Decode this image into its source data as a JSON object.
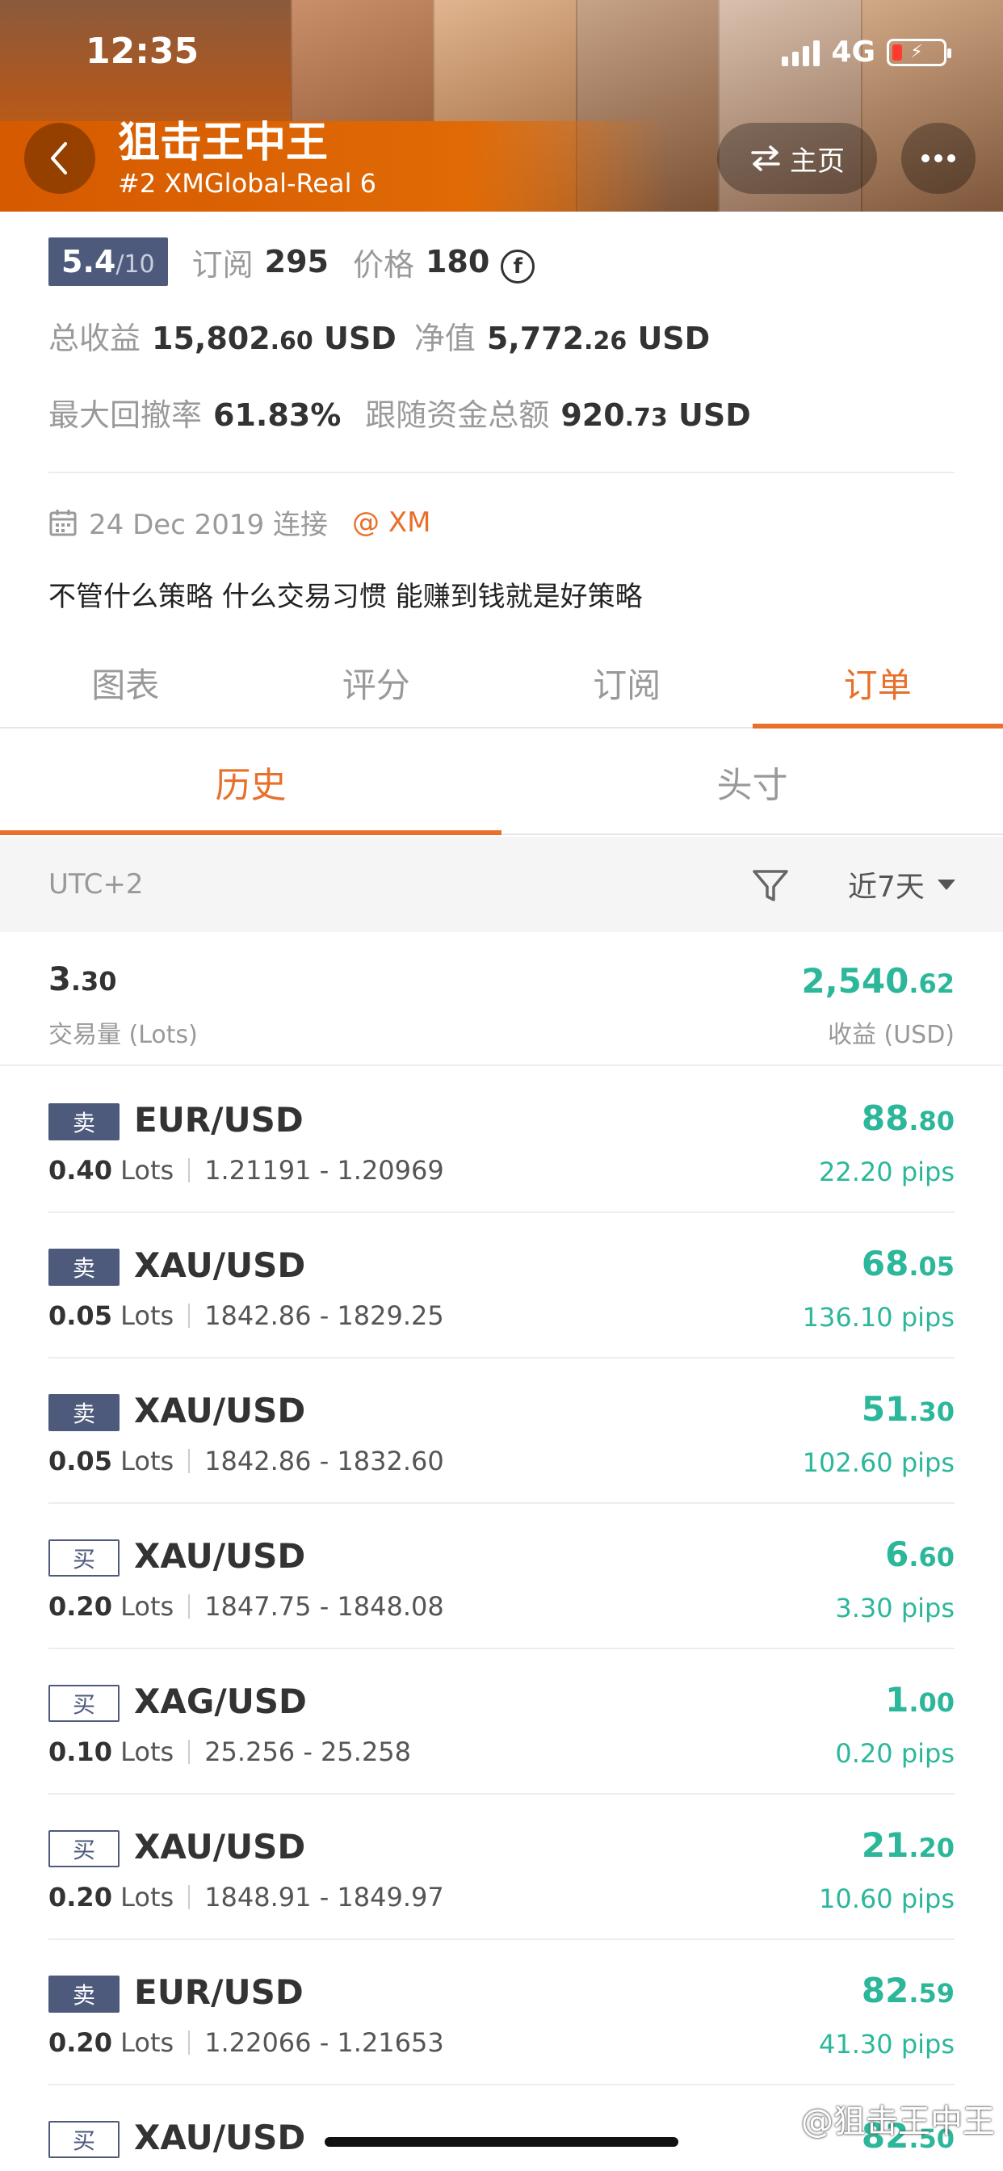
{
  "status_bar": {
    "time": "12:35",
    "network": "4G"
  },
  "header": {
    "title": "狙击王中王",
    "subtitle": "#2 XMGlobal-Real 6",
    "home_label": "主页"
  },
  "profile": {
    "score": "5.4",
    "score_max": "/10",
    "subscribe_label": "订阅",
    "subscribe_value": "295",
    "price_label": "价格",
    "price_value": "180",
    "coin_symbol": "f",
    "total_profit_label": "总收益",
    "total_profit_int": "15,802",
    "total_profit_dec": ".60",
    "total_profit_unit": "USD",
    "equity_label": "净值",
    "equity_int": "5,772",
    "equity_dec": ".26",
    "equity_unit": "USD",
    "max_drawdown_label": "最大回撤率",
    "max_drawdown_value": "61.83%",
    "follow_funds_label": "跟随资金总额",
    "follow_funds_int": "920",
    "follow_funds_dec": ".73",
    "follow_funds_unit": "USD",
    "joined": "24 Dec 2019 连接",
    "broker": "@ XM",
    "motto": "不管什么策略  什么交易习惯 能赚到钱就是好策略"
  },
  "main_tabs": [
    {
      "label": "图表"
    },
    {
      "label": "评分"
    },
    {
      "label": "订阅"
    },
    {
      "label": "订单"
    }
  ],
  "sub_tabs": [
    {
      "label": "历史"
    },
    {
      "label": "头寸"
    }
  ],
  "filter": {
    "timezone": "UTC+2",
    "period": "近7天"
  },
  "summary": {
    "lots_int": "3",
    "lots_dec": ".30",
    "lots_label": "交易量 (Lots)",
    "profit_int": "2,540",
    "profit_dec": ".62",
    "profit_label": "收益 (USD)"
  },
  "orders": [
    {
      "side": "卖",
      "side_type": "sell",
      "symbol": "EUR/USD",
      "lots": "0.40",
      "lots_unit": "Lots",
      "prices": "1.21191 - 1.20969",
      "profit_int": "88",
      "profit_dec": ".80",
      "pips": "22.20 pips"
    },
    {
      "side": "卖",
      "side_type": "sell",
      "symbol": "XAU/USD",
      "lots": "0.05",
      "lots_unit": "Lots",
      "prices": "1842.86 - 1829.25",
      "profit_int": "68",
      "profit_dec": ".05",
      "pips": "136.10 pips"
    },
    {
      "side": "卖",
      "side_type": "sell",
      "symbol": "XAU/USD",
      "lots": "0.05",
      "lots_unit": "Lots",
      "prices": "1842.86 - 1832.60",
      "profit_int": "51",
      "profit_dec": ".30",
      "pips": "102.60 pips"
    },
    {
      "side": "买",
      "side_type": "buy",
      "symbol": "XAU/USD",
      "lots": "0.20",
      "lots_unit": "Lots",
      "prices": "1847.75 - 1848.08",
      "profit_int": "6",
      "profit_dec": ".60",
      "pips": "3.30 pips"
    },
    {
      "side": "买",
      "side_type": "buy",
      "symbol": "XAG/USD",
      "lots": "0.10",
      "lots_unit": "Lots",
      "prices": "25.256 - 25.258",
      "profit_int": "1",
      "profit_dec": ".00",
      "pips": "0.20 pips"
    },
    {
      "side": "买",
      "side_type": "buy",
      "symbol": "XAU/USD",
      "lots": "0.20",
      "lots_unit": "Lots",
      "prices": "1848.91 - 1849.97",
      "profit_int": "21",
      "profit_dec": ".20",
      "pips": "10.60 pips"
    },
    {
      "side": "卖",
      "side_type": "sell",
      "symbol": "EUR/USD",
      "lots": "0.20",
      "lots_unit": "Lots",
      "prices": "1.22066 - 1.21653",
      "profit_int": "82",
      "profit_dec": ".59",
      "pips": "41.30 pips"
    },
    {
      "side": "买",
      "side_type": "buy",
      "symbol": "XAU/USD",
      "lots": "",
      "lots_unit": "",
      "prices": "",
      "profit_int": "82",
      "profit_dec": ".50",
      "pips": ""
    }
  ],
  "watermark": "@狙击王中王",
  "colors": {
    "accent": "#e8702a",
    "profit_green": "#2cb79a",
    "badge_navy": "#4e5a7c"
  }
}
